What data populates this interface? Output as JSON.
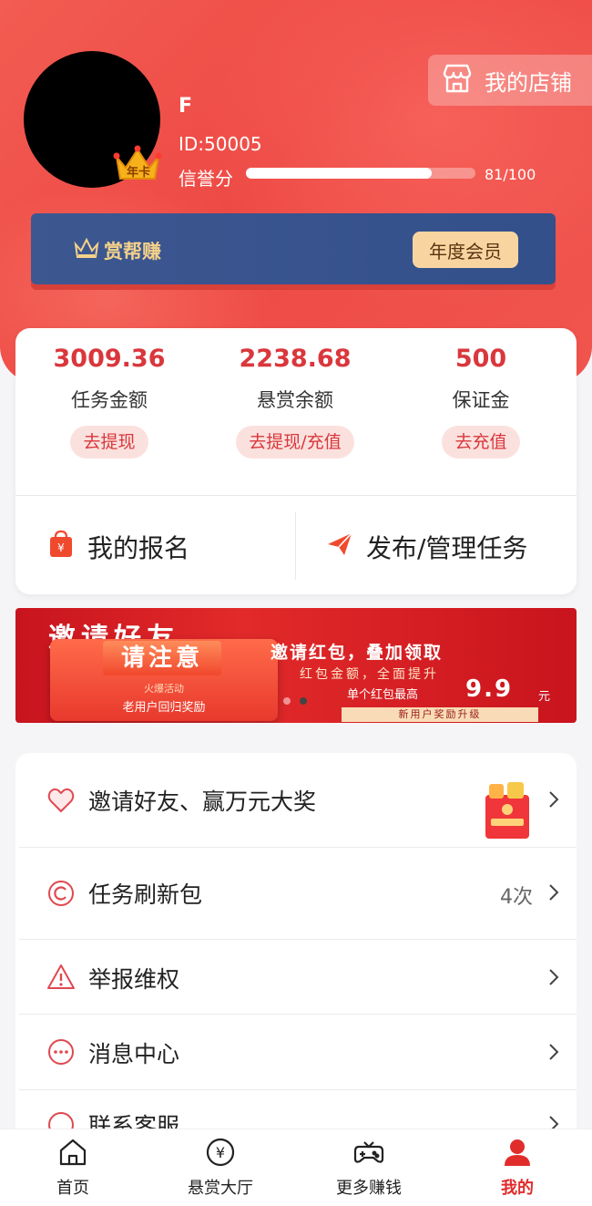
{
  "colors": {
    "accent": "#e12c2c",
    "hero": "#ef4d47",
    "member_card": "#3a5590",
    "gold": "#f8d5a0"
  },
  "profile": {
    "name": "F",
    "id": "ID:50005",
    "badge": "年卡",
    "credit_label": "信誉分",
    "credit_value": "81/100",
    "credit_fraction": 0.81
  },
  "shop_button": {
    "label": "我的店铺",
    "icon": "store-icon"
  },
  "member": {
    "brand": "赏帮赚",
    "tag": "年度会员"
  },
  "balances": [
    {
      "value": "3009.36",
      "label": "任务金额",
      "action": "去提现"
    },
    {
      "value": "2238.68",
      "label": "悬赏余额",
      "action": "去提现/充值"
    },
    {
      "value": "500",
      "label": "保证金",
      "action": "去充值"
    }
  ],
  "actions": [
    {
      "label": "我的报名",
      "icon": "signup-bag-icon"
    },
    {
      "label": "发布/管理任务",
      "icon": "paper-plane-icon"
    }
  ],
  "banner": {
    "title": "邀请好友",
    "box_tag": "请注意",
    "box_small": "火爆活动",
    "box_sub": "老用户回归奖励",
    "line1": "邀请红包，叠加领取",
    "line2": "红包金额，全面提升",
    "line3_pre": "单个红包最高",
    "line3_amount": "9.9",
    "line3_unit": "元",
    "line4": "新用户奖励升级",
    "page_count": 2,
    "active_page": 2
  },
  "menu": [
    {
      "label": "邀请好友、赢万元大奖",
      "icon": "heart-icon",
      "extra": ""
    },
    {
      "label": "任务刷新包",
      "icon": "refresh-icon",
      "extra": "4次"
    },
    {
      "label": "举报维权",
      "icon": "warning-icon",
      "extra": ""
    },
    {
      "label": "消息中心",
      "icon": "message-icon",
      "extra": ""
    },
    {
      "label": "联系客服",
      "icon": "service-icon",
      "extra": ""
    }
  ],
  "tabs": [
    {
      "label": "首页",
      "icon": "home-icon",
      "active": false
    },
    {
      "label": "悬赏大厅",
      "icon": "yuan-icon",
      "active": false
    },
    {
      "label": "更多赚钱",
      "icon": "gamepad-icon",
      "active": false
    },
    {
      "label": "我的",
      "icon": "person-icon",
      "active": true
    }
  ]
}
